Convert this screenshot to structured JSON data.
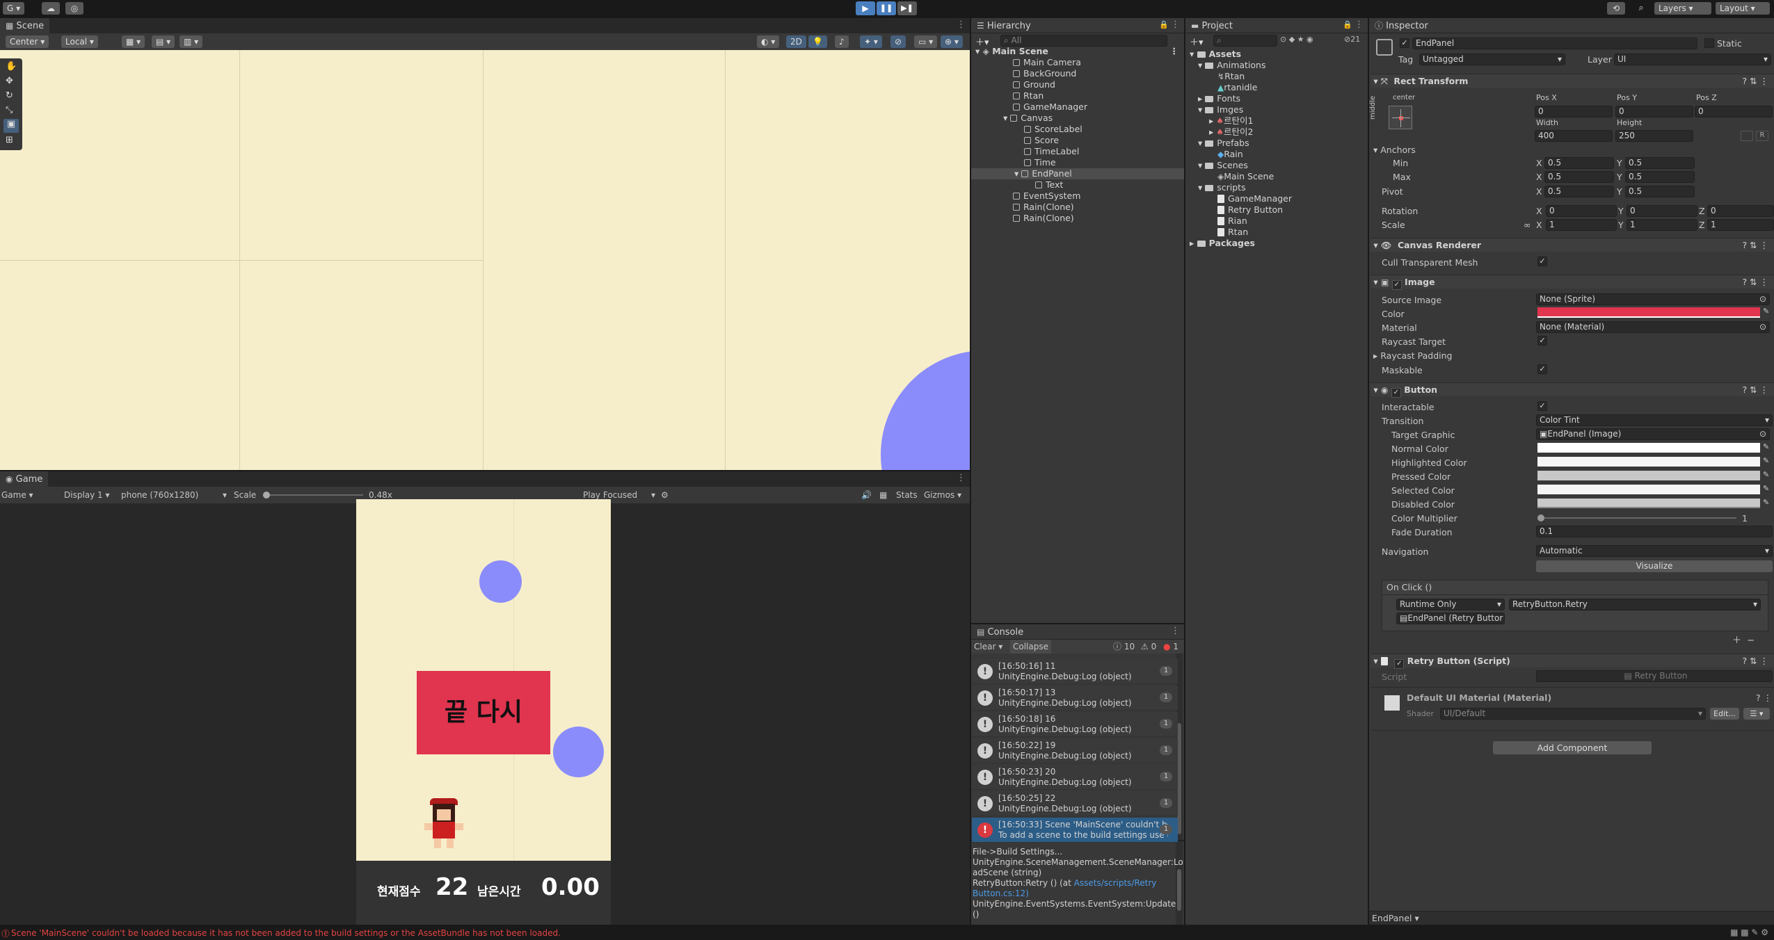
{
  "toolbar": {
    "account": "G",
    "layers": "Layers",
    "layout": "Layout"
  },
  "scene": {
    "tab": "Scene",
    "pivot": "Center",
    "space": "Local",
    "mode2d": "2D"
  },
  "game": {
    "tab": "Game",
    "display_mode": "Game",
    "display": "Display 1",
    "resolution": "phone (760x1280)",
    "scale_label": "Scale",
    "scale_value": "0.48x",
    "play_focus": "Play Focused",
    "stats": "Stats",
    "gizmos": "Gizmos",
    "panel_text": "끝 다시",
    "score_label": "현재점수",
    "score_value": "22",
    "time_label": "남은시간",
    "time_value": "0.00",
    "panel_color": "#e0344f",
    "bg_color": "#f6eecb",
    "ball_color": "#8b8cfb"
  },
  "hierarchy": {
    "tab": "Hierarchy",
    "search": "All",
    "root": "Main Scene",
    "items": [
      "Main Camera",
      "BackGround",
      "Ground",
      "Rtan",
      "GameManager",
      "Canvas",
      "ScoreLabel",
      "Score",
      "TimeLabel",
      "Time",
      "EndPanel",
      "Text",
      "EventSystem",
      "Rain(Clone)",
      "Rain(Clone)"
    ]
  },
  "project": {
    "tab": "Project",
    "count": "21",
    "items": [
      "Assets",
      "Animations",
      "Rtan",
      "rtanidle",
      "Fonts",
      "Imges",
      "르탄이1",
      "르탄이2",
      "Prefabs",
      "Rain",
      "Scenes",
      "Main Scene",
      "scripts",
      "GameManager",
      "Retry Button",
      "Rian",
      "Rtan",
      "Packages"
    ]
  },
  "console": {
    "tab": "Console",
    "clear": "Clear",
    "collapse": "Collapse",
    "log_count": "10",
    "warn_count": "0",
    "err_count": "1",
    "rows": [
      {
        "time": "[16:50:16] 11",
        "msg": "UnityEngine.Debug:Log (object)",
        "count": "1"
      },
      {
        "time": "[16:50:17] 13",
        "msg": "UnityEngine.Debug:Log (object)",
        "count": "1"
      },
      {
        "time": "[16:50:18] 16",
        "msg": "UnityEngine.Debug:Log (object)",
        "count": "1"
      },
      {
        "time": "[16:50:22] 19",
        "msg": "UnityEngine.Debug:Log (object)",
        "count": "1"
      },
      {
        "time": "[16:50:23] 20",
        "msg": "UnityEngine.Debug:Log (object)",
        "count": "1"
      },
      {
        "time": "[16:50:25] 22",
        "msg": "UnityEngine.Debug:Log (object)",
        "count": "1"
      }
    ],
    "error_row": {
      "line1": "[16:50:33] Scene 'MainScene' couldn't be lo",
      "line2": "To add a scene to the build settings use th",
      "count": "1"
    },
    "detail": [
      "File->Build Settings...",
      "UnityEngine.SceneManagement.SceneManager:Lo",
      "adScene (string)",
      "RetryButton:Retry () (at ",
      "Assets/scripts/Retry",
      "Button.cs:12)",
      "UnityEngine.EventSystems.EventSystem:Update ()"
    ]
  },
  "inspector": {
    "tab": "Inspector",
    "object": "EndPanel",
    "static": "Static",
    "tag_label": "Tag",
    "tag": "Untagged",
    "layer_label": "Layer",
    "layer": "UI",
    "rect": {
      "title": "Rect Transform",
      "anchor": "center",
      "side": "middle",
      "posx_label": "Pos X",
      "posy_label": "Pos Y",
      "posz_label": "Pos Z",
      "posx": "0",
      "posy": "0",
      "posz": "0",
      "w_label": "Width",
      "h_label": "Height",
      "w": "400",
      "h": "250",
      "anchors": "Anchors",
      "min": "Min",
      "max": "Max",
      "pivot": "Pivot",
      "half": "0.5",
      "rotation": "Rotation",
      "scale": "Scale",
      "zero": "0",
      "one": "1",
      "x": "X",
      "y": "Y",
      "z": "Z"
    },
    "canvas_renderer": {
      "title": "Canvas Renderer",
      "cull": "Cull Transparent Mesh"
    },
    "image": {
      "title": "Image",
      "source_label": "Source Image",
      "source": "None (Sprite)",
      "color_label": "Color",
      "material_label": "Material",
      "material": "None (Material)",
      "raycast": "Raycast Target",
      "padding": "Raycast Padding",
      "maskable": "Maskable"
    },
    "button": {
      "title": "Button",
      "interactable": "Interactable",
      "transition_label": "Transition",
      "transition": "Color Tint",
      "target_label": "Target Graphic",
      "target": "EndPanel (Image)",
      "normal": "Normal Color",
      "highlighted": "Highlighted Color",
      "pressed": "Pressed Color",
      "selected": "Selected Color",
      "disabled": "Disabled Color",
      "multiplier": "Color Multiplier",
      "multiplier_value": "1",
      "fade": "Fade Duration",
      "fade_value": "0.1",
      "navigation_label": "Navigation",
      "navigation": "Automatic",
      "visualize": "Visualize",
      "onclick": "On Click ()",
      "runtime": "Runtime Only",
      "method": "RetryButton.Retry",
      "obj": "EndPanel (Retry Buttor"
    },
    "retry": {
      "title": "Retry Button (Script)",
      "script_label": "Script",
      "script": "Retry Button"
    },
    "material": {
      "title": "Default UI Material (Material)",
      "shader_label": "Shader",
      "shader": "UI/Default",
      "edit": "Edit..."
    },
    "add": "Add Component",
    "footer": "EndPanel"
  },
  "status": {
    "error": "Scene 'MainScene' couldn't be loaded because it has not been added to the build settings or the AssetBundle has not been loaded."
  }
}
